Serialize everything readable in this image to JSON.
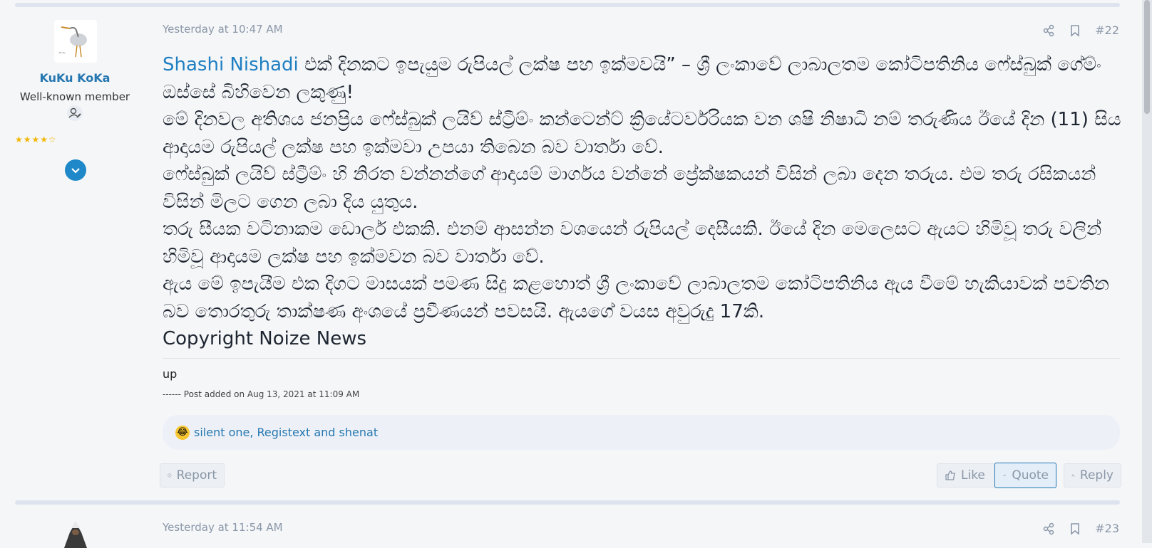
{
  "post22": {
    "time": "Yesterday at 10:47 AM",
    "number": "#22",
    "author": {
      "name": "KuKu KoKa",
      "title": "Well-known member",
      "stars": "★★★★☆"
    },
    "body": {
      "mention": "Shashi Nishadi",
      "paragraphs": [
        " එක් දිනකට ඉපැයුම රුපියල් ලක්ෂ පහ ඉක්මවයි” – ශ්‍රී ලංකාවේ ලාබාලතම කෝටිපතිනිය ෆේස්බුක් ගේම්ං ඔස්සේ බිහිවෙන ලකුණු!",
        "මේ දිනවල අතිශය ජනප්‍රිය ෆේස්බුක් ලයිව් ස්ට්‍රීම්ං කන්ටෙන්ට් ක්‍රියේටර්වරියක වන ශෂි නිෂාධි නම් තරුණිය ඊයේ දින (11) සිය ආදායම රුපියල් ලක්ෂ පහ ඉක්මවා උපයා තිබෙන බව වාර්තා වේ.",
        "ෆේස්බුක් ලයිව් ස්ට්‍රීම්ං හි නිරත වන්නන්ගේ ආදායම් මාර්ගය වන්නේ ප්‍රේක්ෂකයන් විසින් ලබා දෙන තරුය. එම තරු රසිකයන් විසින් මිලට ගෙන ලබා දිය යුතුය.",
        "තරු සීයක වටිනාකම ඩොලර් එකකි. එනම් ආසන්න වශයෙන් රුපියල් දෙසීයකි. ඊයේ දින මෙලෙසට ඇයට හිමිවූ තරු වලින් හිමිවූ ආදායම ලක්ෂ පහ ඉක්මවන බව වාර්තා වේ.",
        "ඇය මේ ඉපැයීම එක දිගට මාසයක් පමණ සිදු කළහොත් ශ්‍රී ලංකාවේ ලාබාලතම කෝටිපතිනිය ඇය වීමේ හැකියාවක් පවතින බව තොරතුරු තාක්ෂණ අංශයේ ප්‍රවීණයන් පවසයි. ඇයගේ වයස අවුරුදු 17කි.",
        "Copyright Noize News"
      ]
    },
    "extra": "up",
    "post_added": "------ Post added on Aug 13, 2021 at 11:09 AM",
    "reactions": "silent one, Registext and shenat",
    "buttons": {
      "report": "Report",
      "like": "Like",
      "quote": "Quote",
      "reply": "Reply"
    }
  },
  "post23": {
    "time": "Yesterday at 11:54 AM",
    "number": "#23"
  },
  "icons": [
    "share-icon",
    "bookmark-icon",
    "user-badge-icon",
    "chevron-down-icon",
    "laugh-emoji-icon",
    "report-icon",
    "like-icon",
    "quote-icon",
    "reply-icon"
  ],
  "colors": {
    "link": "#2577b1",
    "muted": "#8a97a8",
    "accent": "#1e88c9"
  }
}
